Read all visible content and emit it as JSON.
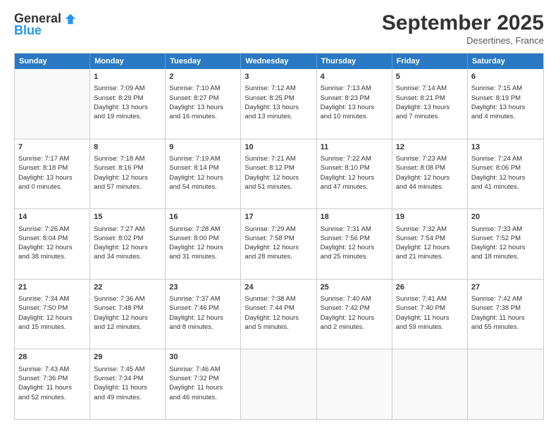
{
  "logo": {
    "general": "General",
    "blue": "Blue"
  },
  "title": "September 2025",
  "subtitle": "Desertines, France",
  "days": [
    "Sunday",
    "Monday",
    "Tuesday",
    "Wednesday",
    "Thursday",
    "Friday",
    "Saturday"
  ],
  "weeks": [
    [
      {
        "num": "",
        "lines": []
      },
      {
        "num": "1",
        "lines": [
          "Sunrise: 7:09 AM",
          "Sunset: 8:29 PM",
          "Daylight: 13 hours",
          "and 19 minutes."
        ]
      },
      {
        "num": "2",
        "lines": [
          "Sunrise: 7:10 AM",
          "Sunset: 8:27 PM",
          "Daylight: 13 hours",
          "and 16 minutes."
        ]
      },
      {
        "num": "3",
        "lines": [
          "Sunrise: 7:12 AM",
          "Sunset: 8:25 PM",
          "Daylight: 13 hours",
          "and 13 minutes."
        ]
      },
      {
        "num": "4",
        "lines": [
          "Sunrise: 7:13 AM",
          "Sunset: 8:23 PM",
          "Daylight: 13 hours",
          "and 10 minutes."
        ]
      },
      {
        "num": "5",
        "lines": [
          "Sunrise: 7:14 AM",
          "Sunset: 8:21 PM",
          "Daylight: 13 hours",
          "and 7 minutes."
        ]
      },
      {
        "num": "6",
        "lines": [
          "Sunrise: 7:15 AM",
          "Sunset: 8:19 PM",
          "Daylight: 13 hours",
          "and 4 minutes."
        ]
      }
    ],
    [
      {
        "num": "7",
        "lines": [
          "Sunrise: 7:17 AM",
          "Sunset: 8:18 PM",
          "Daylight: 13 hours",
          "and 0 minutes."
        ]
      },
      {
        "num": "8",
        "lines": [
          "Sunrise: 7:18 AM",
          "Sunset: 8:16 PM",
          "Daylight: 12 hours",
          "and 57 minutes."
        ]
      },
      {
        "num": "9",
        "lines": [
          "Sunrise: 7:19 AM",
          "Sunset: 8:14 PM",
          "Daylight: 12 hours",
          "and 54 minutes."
        ]
      },
      {
        "num": "10",
        "lines": [
          "Sunrise: 7:21 AM",
          "Sunset: 8:12 PM",
          "Daylight: 12 hours",
          "and 51 minutes."
        ]
      },
      {
        "num": "11",
        "lines": [
          "Sunrise: 7:22 AM",
          "Sunset: 8:10 PM",
          "Daylight: 12 hours",
          "and 47 minutes."
        ]
      },
      {
        "num": "12",
        "lines": [
          "Sunrise: 7:23 AM",
          "Sunset: 8:08 PM",
          "Daylight: 12 hours",
          "and 44 minutes."
        ]
      },
      {
        "num": "13",
        "lines": [
          "Sunrise: 7:24 AM",
          "Sunset: 8:06 PM",
          "Daylight: 12 hours",
          "and 41 minutes."
        ]
      }
    ],
    [
      {
        "num": "14",
        "lines": [
          "Sunrise: 7:26 AM",
          "Sunset: 8:04 PM",
          "Daylight: 12 hours",
          "and 38 minutes."
        ]
      },
      {
        "num": "15",
        "lines": [
          "Sunrise: 7:27 AM",
          "Sunset: 8:02 PM",
          "Daylight: 12 hours",
          "and 34 minutes."
        ]
      },
      {
        "num": "16",
        "lines": [
          "Sunrise: 7:28 AM",
          "Sunset: 8:00 PM",
          "Daylight: 12 hours",
          "and 31 minutes."
        ]
      },
      {
        "num": "17",
        "lines": [
          "Sunrise: 7:29 AM",
          "Sunset: 7:58 PM",
          "Daylight: 12 hours",
          "and 28 minutes."
        ]
      },
      {
        "num": "18",
        "lines": [
          "Sunrise: 7:31 AM",
          "Sunset: 7:56 PM",
          "Daylight: 12 hours",
          "and 25 minutes."
        ]
      },
      {
        "num": "19",
        "lines": [
          "Sunrise: 7:32 AM",
          "Sunset: 7:54 PM",
          "Daylight: 12 hours",
          "and 21 minutes."
        ]
      },
      {
        "num": "20",
        "lines": [
          "Sunrise: 7:33 AM",
          "Sunset: 7:52 PM",
          "Daylight: 12 hours",
          "and 18 minutes."
        ]
      }
    ],
    [
      {
        "num": "21",
        "lines": [
          "Sunrise: 7:34 AM",
          "Sunset: 7:50 PM",
          "Daylight: 12 hours",
          "and 15 minutes."
        ]
      },
      {
        "num": "22",
        "lines": [
          "Sunrise: 7:36 AM",
          "Sunset: 7:48 PM",
          "Daylight: 12 hours",
          "and 12 minutes."
        ]
      },
      {
        "num": "23",
        "lines": [
          "Sunrise: 7:37 AM",
          "Sunset: 7:46 PM",
          "Daylight: 12 hours",
          "and 8 minutes."
        ]
      },
      {
        "num": "24",
        "lines": [
          "Sunrise: 7:38 AM",
          "Sunset: 7:44 PM",
          "Daylight: 12 hours",
          "and 5 minutes."
        ]
      },
      {
        "num": "25",
        "lines": [
          "Sunrise: 7:40 AM",
          "Sunset: 7:42 PM",
          "Daylight: 12 hours",
          "and 2 minutes."
        ]
      },
      {
        "num": "26",
        "lines": [
          "Sunrise: 7:41 AM",
          "Sunset: 7:40 PM",
          "Daylight: 11 hours",
          "and 59 minutes."
        ]
      },
      {
        "num": "27",
        "lines": [
          "Sunrise: 7:42 AM",
          "Sunset: 7:38 PM",
          "Daylight: 11 hours",
          "and 55 minutes."
        ]
      }
    ],
    [
      {
        "num": "28",
        "lines": [
          "Sunrise: 7:43 AM",
          "Sunset: 7:36 PM",
          "Daylight: 11 hours",
          "and 52 minutes."
        ]
      },
      {
        "num": "29",
        "lines": [
          "Sunrise: 7:45 AM",
          "Sunset: 7:34 PM",
          "Daylight: 11 hours",
          "and 49 minutes."
        ]
      },
      {
        "num": "30",
        "lines": [
          "Sunrise: 7:46 AM",
          "Sunset: 7:32 PM",
          "Daylight: 11 hours",
          "and 46 minutes."
        ]
      },
      {
        "num": "",
        "lines": []
      },
      {
        "num": "",
        "lines": []
      },
      {
        "num": "",
        "lines": []
      },
      {
        "num": "",
        "lines": []
      }
    ]
  ]
}
